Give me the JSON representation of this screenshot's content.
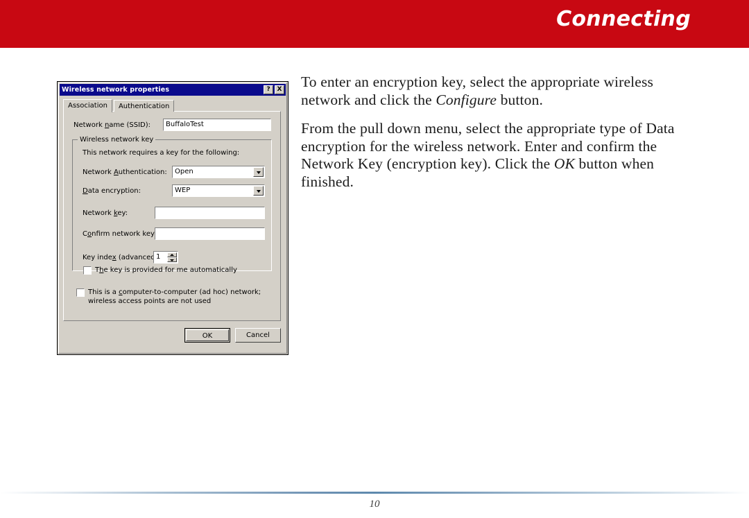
{
  "header": {
    "title": "Connecting",
    "banner_color": "#c80812"
  },
  "body": {
    "paragraph1": {
      "part1": "To enter an encryption key, select the appropriate wireless network and click the ",
      "emphasis": "Configure",
      "part2": " button."
    },
    "paragraph2": {
      "part1": "From the pull down menu, select the appropriate type of  Data encryption for the wireless network.  Enter and confirm the Network Key (encryption key).  Click the ",
      "emphasis": "OK",
      "part2": " button when finished."
    }
  },
  "dialog": {
    "title": "Wireless network properties",
    "help_button": "?",
    "close_button": "X",
    "tabs": [
      {
        "label": "Association",
        "active": true
      },
      {
        "label": "Authentication",
        "active": false
      }
    ],
    "ssid_label_pre": "Network ",
    "ssid_label_accel": "n",
    "ssid_label_post": "ame (SSID):",
    "ssid_value": "BuffaloTest",
    "group_title": "Wireless network key",
    "group_hint": "This network requires a key for the following:",
    "auth_label_pre": "Network ",
    "auth_label_accel": "A",
    "auth_label_post": "uthentication:",
    "auth_value": "Open",
    "encryption_label_pre": "",
    "encryption_label_accel": "D",
    "encryption_label_post": "ata encryption:",
    "encryption_value": "WEP",
    "network_key_label_pre": "Network ",
    "network_key_label_accel": "k",
    "network_key_label_post": "ey:",
    "network_key_value": "",
    "confirm_key_label_pre": "C",
    "confirm_key_label_accel": "o",
    "confirm_key_label_post": "nfirm network key:",
    "confirm_key_value": "",
    "key_index_label_pre": "Key inde",
    "key_index_label_accel": "x",
    "key_index_label_post": " (advanced):",
    "key_index_value": "1",
    "auto_key_checkbox": {
      "pre": "T",
      "accel": "h",
      "post": "e key is provided for me automatically",
      "checked": false
    },
    "adhoc_checkbox": {
      "pre": "This is a ",
      "accel": "c",
      "post": "omputer-to-computer (ad hoc) network; wireless access points are not used",
      "checked": false
    },
    "ok_button": "OK",
    "cancel_button": "Cancel"
  },
  "footer": {
    "page_number": "10"
  }
}
